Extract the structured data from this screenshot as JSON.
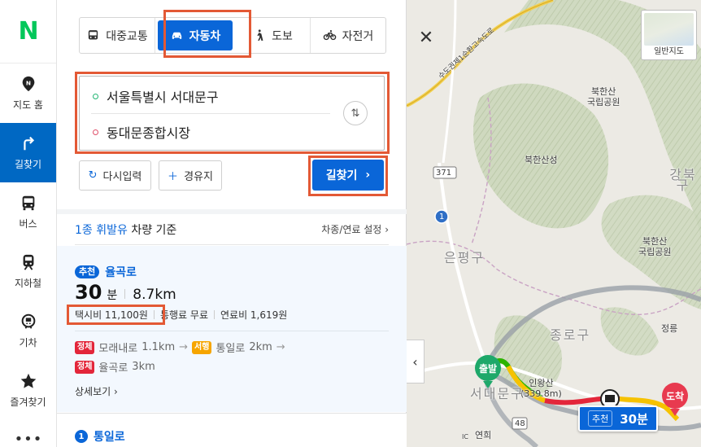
{
  "brand": {
    "logo_text": "N"
  },
  "rail": {
    "items": [
      {
        "label": "지도 홈",
        "icon": "map-pin-icon"
      },
      {
        "label": "길찾기",
        "icon": "directions-icon"
      },
      {
        "label": "버스",
        "icon": "bus-icon"
      },
      {
        "label": "지하철",
        "icon": "subway-icon"
      },
      {
        "label": "기차",
        "icon": "train-icon"
      },
      {
        "label": "즐겨찾기",
        "icon": "star-icon"
      }
    ],
    "more": "•••"
  },
  "modes": {
    "transit": "대중교통",
    "car": "자동차",
    "walk": "도보",
    "bike": "자전거",
    "active": "자동차"
  },
  "route": {
    "origin": "서울특별시 서대문구",
    "destination": "동대문종합시장",
    "swap_glyph": "⇅"
  },
  "actions": {
    "reset": "다시입력",
    "waypoint": "경유지",
    "search": "길찾기",
    "search_chevron": "›"
  },
  "fuel": {
    "fuel_type": "1종 휘발유",
    "basis": "차량 기준",
    "settings": "차종/연료 설정",
    "settings_chevron": "›"
  },
  "results": [
    {
      "badge": "추천",
      "route_name": "율곡로",
      "minutes": "30",
      "minutes_unit": "분",
      "distance": "8.7km",
      "taxi_fare": "택시비 11,100원",
      "toll": "통행료 무료",
      "fuel_cost": "연료비 1,619원",
      "segments_line1": [
        {
          "status": "정체",
          "status_color": "red",
          "road": "모래내로",
          "length": "1.1km"
        },
        {
          "status": "서행",
          "status_color": "yellow",
          "road": "통일로",
          "length": "2km"
        }
      ],
      "segments_line2": [
        {
          "status": "정체",
          "status_color": "red",
          "road": "율곡로",
          "length": "3km"
        }
      ],
      "arrow": "→",
      "detail": "상세보기",
      "detail_chevron": "›"
    },
    {
      "number": "1",
      "route_name": "통일로"
    }
  ],
  "map": {
    "map_type_label": "일반지도",
    "close_glyph": "✕",
    "collapse_glyph": "‹",
    "labels": {
      "park1": "북한산\n국립공원",
      "fortress": "북한산성",
      "park2": "북한산\n국립공원",
      "jeongneung": "정릉",
      "inwangsan": "인왕산\n(339.8m)",
      "yeonhui": "연희",
      "road_371": "371",
      "road_1": "1",
      "road_48": "48",
      "road_ic": "IC",
      "capital_ring": "수도권제1순환고속도로",
      "district_eunpyeong": "은평구",
      "district_jongno": "종로구",
      "district_seodaemun": "서대문구",
      "district_gangbuk": "강북구"
    },
    "start_label": "출발",
    "end_label": "도착",
    "summary_tag": "추천",
    "summary_time": "30분",
    "colors": {
      "accent": "#0a66d8",
      "start": "#1ea86a",
      "end": "#e83a4f",
      "highlight": "#e35935",
      "jam": "#e3263a",
      "slow": "#f6a500",
      "smooth": "#2db400"
    }
  }
}
